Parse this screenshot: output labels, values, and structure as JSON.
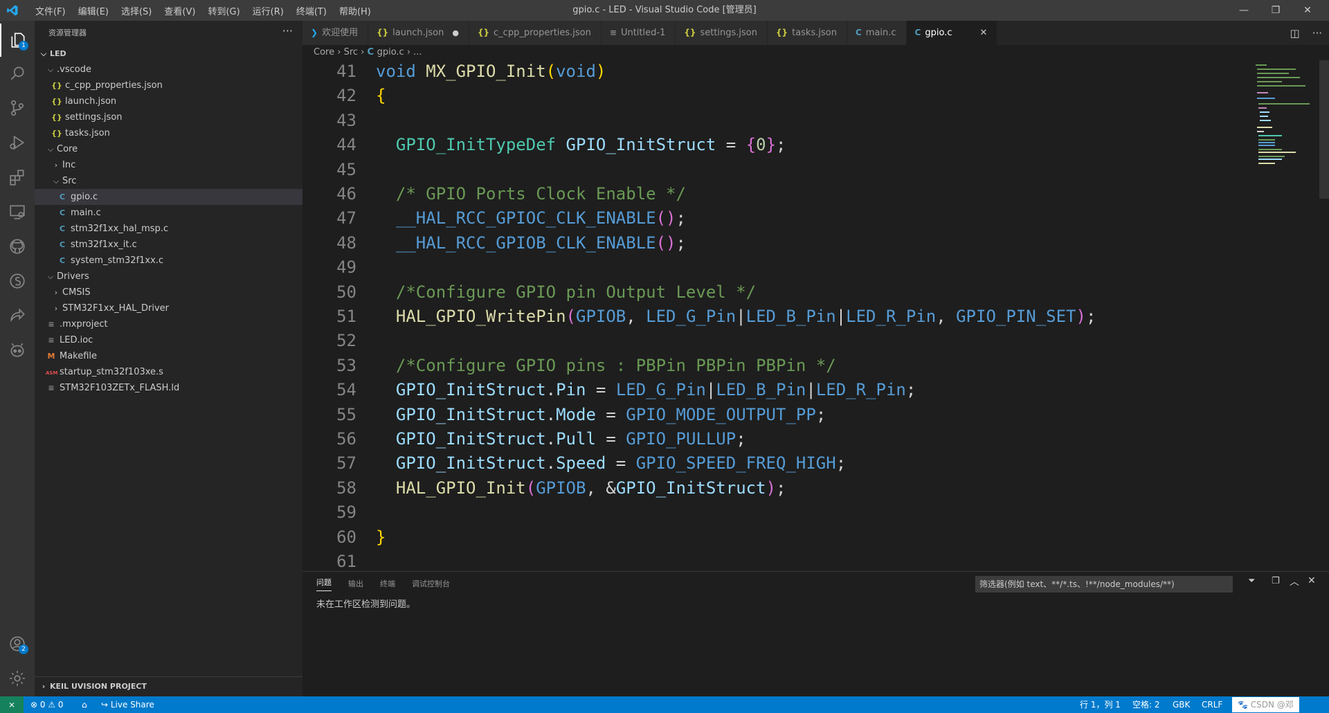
{
  "titlebar": {
    "menus": [
      "文件(F)",
      "编辑(E)",
      "选择(S)",
      "查看(V)",
      "转到(G)",
      "运行(R)",
      "终端(T)",
      "帮助(H)"
    ],
    "title": "gpio.c - LED - Visual Studio Code [管理员]"
  },
  "activity": {
    "explorer_badge": "1",
    "accounts_badge": "2"
  },
  "sidebar": {
    "header": "资源管理器",
    "more": "···",
    "root": "LED",
    "items": [
      {
        "label": ".vscode",
        "depth": 1,
        "kind": "folder-open"
      },
      {
        "label": "c_cpp_properties.json",
        "depth": 2,
        "kind": "json"
      },
      {
        "label": "launch.json",
        "depth": 2,
        "kind": "json"
      },
      {
        "label": "settings.json",
        "depth": 2,
        "kind": "json"
      },
      {
        "label": "tasks.json",
        "depth": 2,
        "kind": "json"
      },
      {
        "label": "Core",
        "depth": 1,
        "kind": "folder-open"
      },
      {
        "label": "Inc",
        "depth": 2,
        "kind": "folder-closed"
      },
      {
        "label": "Src",
        "depth": 2,
        "kind": "folder-open"
      },
      {
        "label": "gpio.c",
        "depth": 3,
        "kind": "c",
        "selected": true
      },
      {
        "label": "main.c",
        "depth": 3,
        "kind": "c"
      },
      {
        "label": "stm32f1xx_hal_msp.c",
        "depth": 3,
        "kind": "c"
      },
      {
        "label": "stm32f1xx_it.c",
        "depth": 3,
        "kind": "c"
      },
      {
        "label": "system_stm32f1xx.c",
        "depth": 3,
        "kind": "c"
      },
      {
        "label": "Drivers",
        "depth": 1,
        "kind": "folder-open"
      },
      {
        "label": "CMSIS",
        "depth": 2,
        "kind": "folder-closed"
      },
      {
        "label": "STM32F1xx_HAL_Driver",
        "depth": 2,
        "kind": "folder-closed"
      },
      {
        "label": ".mxproject",
        "depth": 1,
        "kind": "text"
      },
      {
        "label": "LED.ioc",
        "depth": 1,
        "kind": "text"
      },
      {
        "label": "Makefile",
        "depth": 1,
        "kind": "makefile"
      },
      {
        "label": "startup_stm32f103xe.s",
        "depth": 1,
        "kind": "asm"
      },
      {
        "label": "STM32F103ZETx_FLASH.ld",
        "depth": 1,
        "kind": "text"
      }
    ],
    "bottom_section": "KEIL UVISION PROJECT"
  },
  "tabs": [
    {
      "label": "欢迎使用",
      "icon": "vscode-icon",
      "glyph": "❯"
    },
    {
      "label": "launch.json",
      "icon": "json-icon",
      "glyph": "{}",
      "modified": true
    },
    {
      "label": "c_cpp_properties.json",
      "icon": "json-icon",
      "glyph": "{}"
    },
    {
      "label": "Untitled-1",
      "icon": "text-icon",
      "glyph": "≡"
    },
    {
      "label": "settings.json",
      "icon": "json-icon",
      "glyph": "{}"
    },
    {
      "label": "tasks.json",
      "icon": "json-icon",
      "glyph": "{}"
    },
    {
      "label": "main.c",
      "icon": "c-icon",
      "glyph": "C"
    },
    {
      "label": "gpio.c",
      "icon": "c-icon",
      "glyph": "C",
      "active": true
    }
  ],
  "breadcrumb": {
    "parts": [
      "Core",
      "Src",
      "gpio.c",
      "..."
    ]
  },
  "editor": {
    "lines": [
      {
        "n": "41",
        "html": "<span class='kw'>void</span> <span class='fn'>MX_GPIO_Init</span><span class='br1'>(</span><span class='kw'>void</span><span class='br1'>)</span>"
      },
      {
        "n": "42",
        "html": "<span class='br1'>{</span>"
      },
      {
        "n": "43",
        "html": ""
      },
      {
        "n": "44",
        "html": "  <span class='ty'>GPIO_InitTypeDef</span> <span class='var'>GPIO_InitStruct</span> = <span class='br2'>{</span><span class='num'>0</span><span class='br2'>}</span>;"
      },
      {
        "n": "45",
        "html": ""
      },
      {
        "n": "46",
        "html": "  <span class='cm'>/* GPIO Ports Clock Enable */</span>"
      },
      {
        "n": "47",
        "html": "  <span class='mac'>__HAL_RCC_GPIOC_CLK_ENABLE</span><span class='br2'>()</span>;"
      },
      {
        "n": "48",
        "html": "  <span class='mac'>__HAL_RCC_GPIOB_CLK_ENABLE</span><span class='br2'>()</span>;"
      },
      {
        "n": "49",
        "html": ""
      },
      {
        "n": "50",
        "html": "  <span class='cm'>/*Configure GPIO pin Output Level */</span>"
      },
      {
        "n": "51",
        "html": "  <span class='fn'>HAL_GPIO_WritePin</span><span class='br2'>(</span><span class='mac'>GPIOB</span>, <span class='mac'>LED_G_Pin</span>|<span class='mac'>LED_B_Pin</span>|<span class='mac'>LED_R_Pin</span>, <span class='mac'>GPIO_PIN_SET</span><span class='br2'>)</span>;"
      },
      {
        "n": "52",
        "html": ""
      },
      {
        "n": "53",
        "html": "  <span class='cm'>/*Configure GPIO pins : PBPin PBPin PBPin */</span>"
      },
      {
        "n": "54",
        "html": "  <span class='var'>GPIO_InitStruct</span>.<span class='var'>Pin</span> = <span class='mac'>LED_G_Pin</span>|<span class='mac'>LED_B_Pin</span>|<span class='mac'>LED_R_Pin</span>;"
      },
      {
        "n": "55",
        "html": "  <span class='var'>GPIO_InitStruct</span>.<span class='var'>Mode</span> = <span class='mac'>GPIO_MODE_OUTPUT_PP</span>;"
      },
      {
        "n": "56",
        "html": "  <span class='var'>GPIO_InitStruct</span>.<span class='var'>Pull</span> = <span class='mac'>GPIO_PULLUP</span>;"
      },
      {
        "n": "57",
        "html": "  <span class='var'>GPIO_InitStruct</span>.<span class='var'>Speed</span> = <span class='mac'>GPIO_SPEED_FREQ_HIGH</span>;"
      },
      {
        "n": "58",
        "html": "  <span class='fn'>HAL_GPIO_Init</span><span class='br2'>(</span><span class='mac'>GPIOB</span>, &amp;<span class='var'>GPIO_InitStruct</span><span class='br2'>)</span>;"
      },
      {
        "n": "59",
        "html": ""
      },
      {
        "n": "60",
        "html": "<span class='br1'>}</span>"
      },
      {
        "n": "61",
        "html": ""
      }
    ]
  },
  "panel": {
    "tabs": [
      "问题",
      "输出",
      "终端",
      "调试控制台"
    ],
    "filter_placeholder": "筛选器(例如 text、**/*.ts、!**/node_modules/**)",
    "message": "未在工作区检测到问题。"
  },
  "status": {
    "problems": "⊗ 0 ⚠ 0",
    "live_share": "Live Share",
    "position": "行 1，列 1",
    "spaces": "空格: 2",
    "encoding": "GBK",
    "eol": "CRLF",
    "watermark": "CSDN @邓"
  },
  "colors": {
    "accent": "#007acc",
    "status_bg": "#007acc",
    "remote_bg": "#16825d"
  }
}
